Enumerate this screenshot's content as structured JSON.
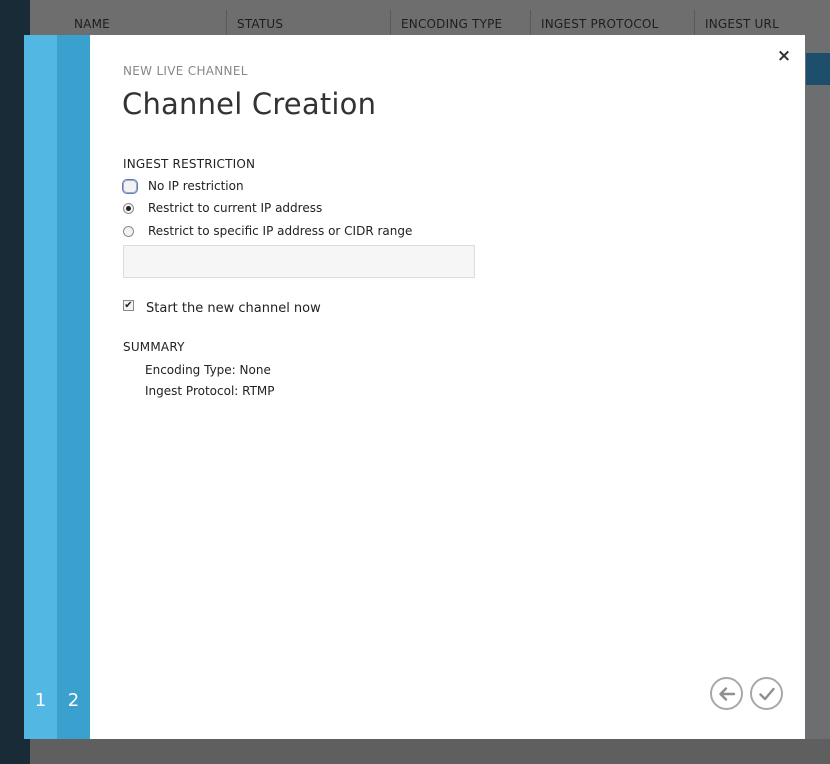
{
  "background": {
    "columns": [
      "NAME",
      "STATUS",
      "ENCODING TYPE",
      "INGEST PROTOCOL",
      "INGEST URL"
    ]
  },
  "wizard": {
    "steps": [
      "1",
      "2"
    ],
    "eyebrow": "NEW LIVE CHANNEL",
    "title": "Channel Creation",
    "ingest": {
      "label": "INGEST RESTRICTION",
      "options": [
        {
          "label": "No IP restriction",
          "checked": false
        },
        {
          "label": "Restrict to current IP address",
          "checked": true
        },
        {
          "label": "Restrict to specific IP address or CIDR range",
          "checked": false
        }
      ],
      "ip_value": ""
    },
    "start_now": {
      "label": "Start the new channel now",
      "checked": true
    },
    "summary": {
      "label": "SUMMARY",
      "lines": [
        "Encoding Type: None",
        "Ingest Protocol: RTMP"
      ]
    },
    "close_glyph": "×",
    "checkbox_glyph": "✔"
  },
  "icons": {
    "back": "arrow-left-icon",
    "finish": "checkmark-icon",
    "close": "close-icon"
  }
}
